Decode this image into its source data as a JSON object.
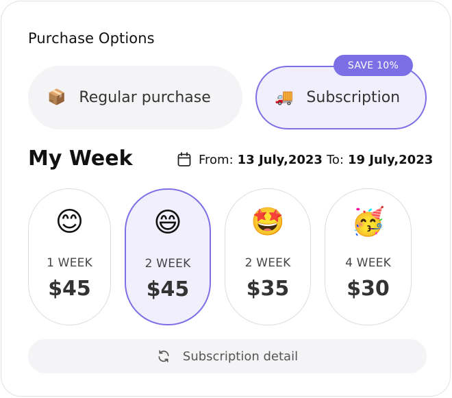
{
  "purchase_options": {
    "title": "Purchase Options",
    "regular": {
      "icon": "📦",
      "icon_name": "package-icon",
      "label": "Regular purchase"
    },
    "subscription": {
      "icon": "🚚",
      "icon_name": "delivery-truck-icon",
      "label": "Subscription",
      "badge": "SAVE 10%",
      "selected": true
    }
  },
  "week": {
    "title": "My Week",
    "from_label": "From:",
    "from_date": "13 July,2023",
    "to_label": "To:",
    "to_date": "19 July,2023",
    "calendar_icon": "calendar-icon"
  },
  "plans": [
    {
      "emoji": "😊",
      "icon_name": "smiling-face-icon",
      "label": "1 WEEK",
      "price": "$45",
      "selected": false
    },
    {
      "emoji": "😄",
      "icon_name": "grinning-face-icon",
      "label": "2 WEEK",
      "price": "$45",
      "selected": true
    },
    {
      "emoji": "🤩",
      "icon_name": "star-struck-face-icon",
      "label": "2 WEEK",
      "price": "$35",
      "selected": false
    },
    {
      "emoji": "🥳",
      "icon_name": "partying-face-icon",
      "label": "4 WEEK",
      "price": "$30",
      "selected": false
    }
  ],
  "detail_button": {
    "label": "Subscription detail",
    "icon_name": "refresh-icon"
  },
  "colors": {
    "accent": "#7c6fe6",
    "selected_bg": "#f1effc",
    "neutral_bg": "#f4f4f6",
    "border": "#dcdce0"
  }
}
